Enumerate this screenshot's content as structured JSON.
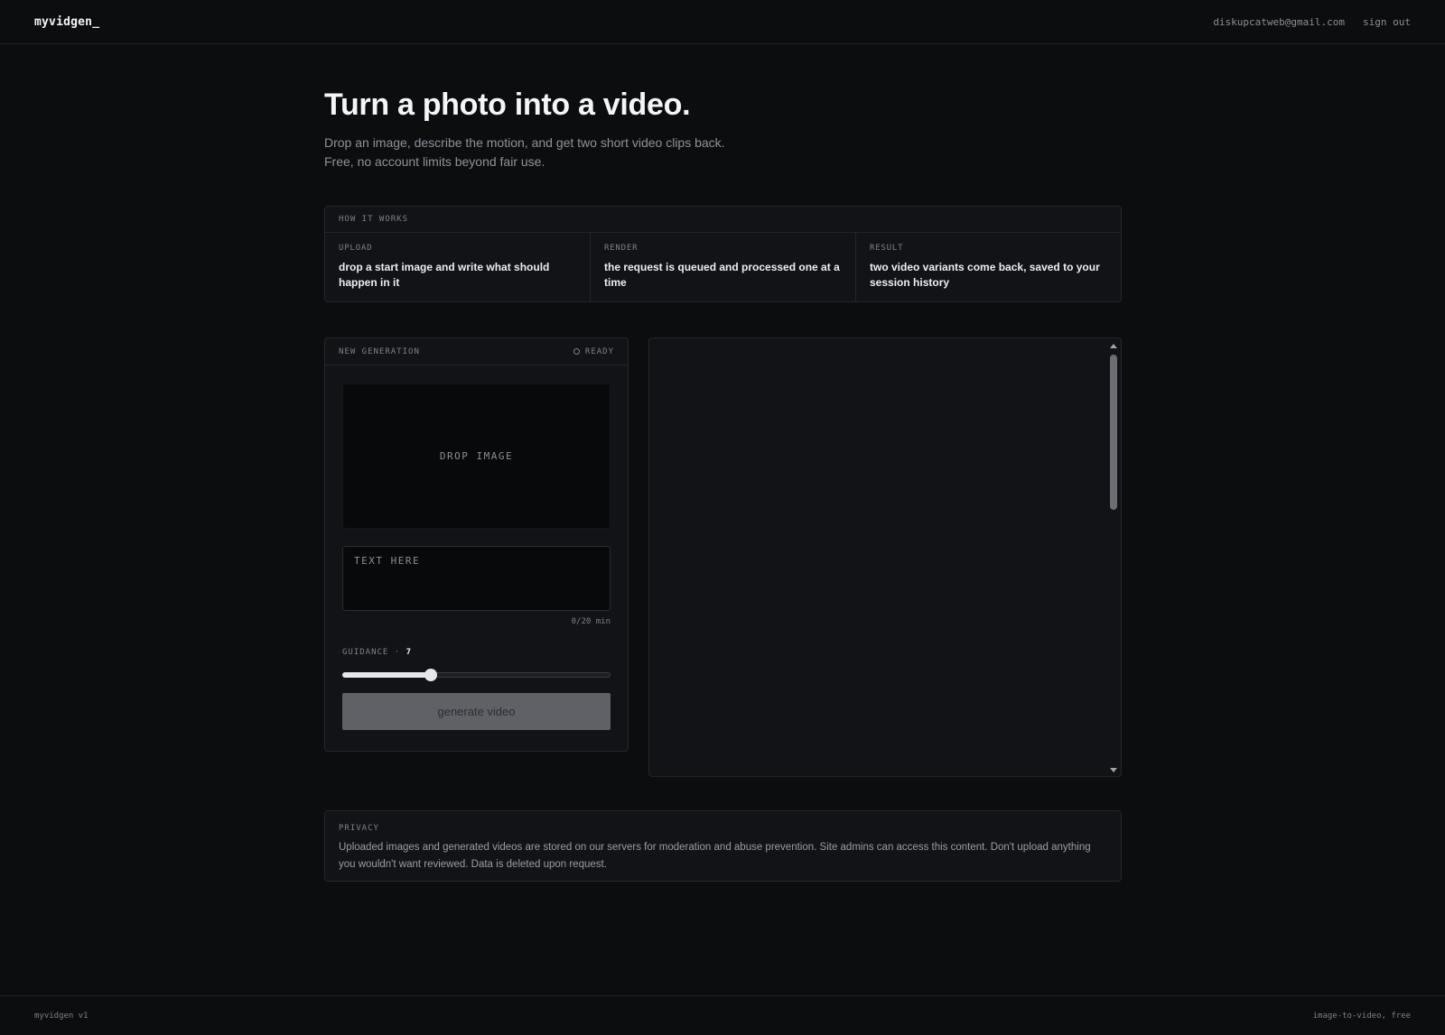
{
  "header": {
    "brand": "myvidgen_",
    "user_email": "diskupcatweb@gmail.com",
    "sign_out": "sign out"
  },
  "hero": {
    "title": "Turn a photo into a video.",
    "subtitle_line1": "Drop an image, describe the motion, and get two short video clips back.",
    "subtitle_line2": "Free, no account limits beyond fair use."
  },
  "how_it_works": {
    "heading": "HOW IT WORKS",
    "steps": [
      {
        "label": "UPLOAD",
        "text": "drop a start image and write what should happen in it"
      },
      {
        "label": "RENDER",
        "text": "the request is queued and processed one at a time"
      },
      {
        "label": "RESULT",
        "text": "two video variants come back, saved to your session history"
      }
    ]
  },
  "generator": {
    "heading": "NEW GENERATION",
    "status": "READY",
    "dropzone_label": "DROP IMAGE",
    "prompt_placeholder": "TEXT HERE",
    "prompt_value": "",
    "char_counter": "0/20 min",
    "guidance_label": "GUIDANCE ·",
    "guidance_value": "7",
    "guidance_fraction": 0.33,
    "button_label": "generate video"
  },
  "privacy": {
    "label": "PRIVACY",
    "text": "Uploaded images and generated videos are stored on our servers for moderation and abuse prevention. Site admins can access this content. Don't upload anything you wouldn't want reviewed. Data is deleted upon request."
  },
  "footer": {
    "left": "myvidgen v1",
    "right": "image-to-video, free"
  }
}
